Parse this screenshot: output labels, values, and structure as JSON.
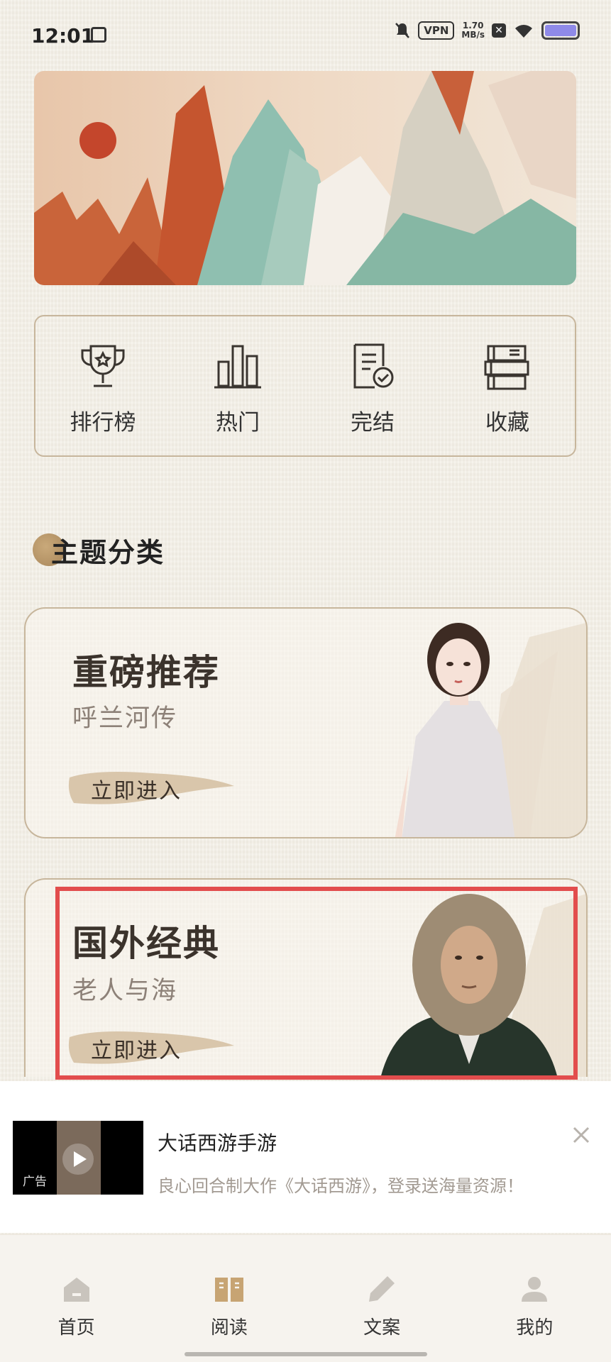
{
  "status_bar": {
    "time": "12:01",
    "vpn": "VPN",
    "speed_value": "1.70",
    "speed_unit": "MB/s"
  },
  "quick_entries": [
    {
      "label": "排行榜",
      "icon": "trophy-icon"
    },
    {
      "label": "热门",
      "icon": "bar-chart-icon"
    },
    {
      "label": "完结",
      "icon": "document-check-icon"
    },
    {
      "label": "收藏",
      "icon": "books-icon"
    }
  ],
  "section": {
    "title": "主题分类"
  },
  "categories": [
    {
      "title": "重磅推荐",
      "subtitle": "呼兰河传",
      "button": "立即进入"
    },
    {
      "title": "国外经典",
      "subtitle": "老人与海",
      "button": "立即进入"
    }
  ],
  "ad": {
    "tag": "广告",
    "name": "大话西游手游",
    "description": "良心回合制大作《大话西游》，登录送海量资源！"
  },
  "tabbar": [
    {
      "label": "首页",
      "icon": "home-icon"
    },
    {
      "label": "阅读",
      "icon": "book-open-icon"
    },
    {
      "label": "文案",
      "icon": "pencil-icon"
    },
    {
      "label": "我的",
      "icon": "profile-icon"
    }
  ],
  "colors": {
    "background": "#f3efe6",
    "card_border": "#c7b69c",
    "highlight": "#e24d4d",
    "active_tab": "#c7a473"
  }
}
